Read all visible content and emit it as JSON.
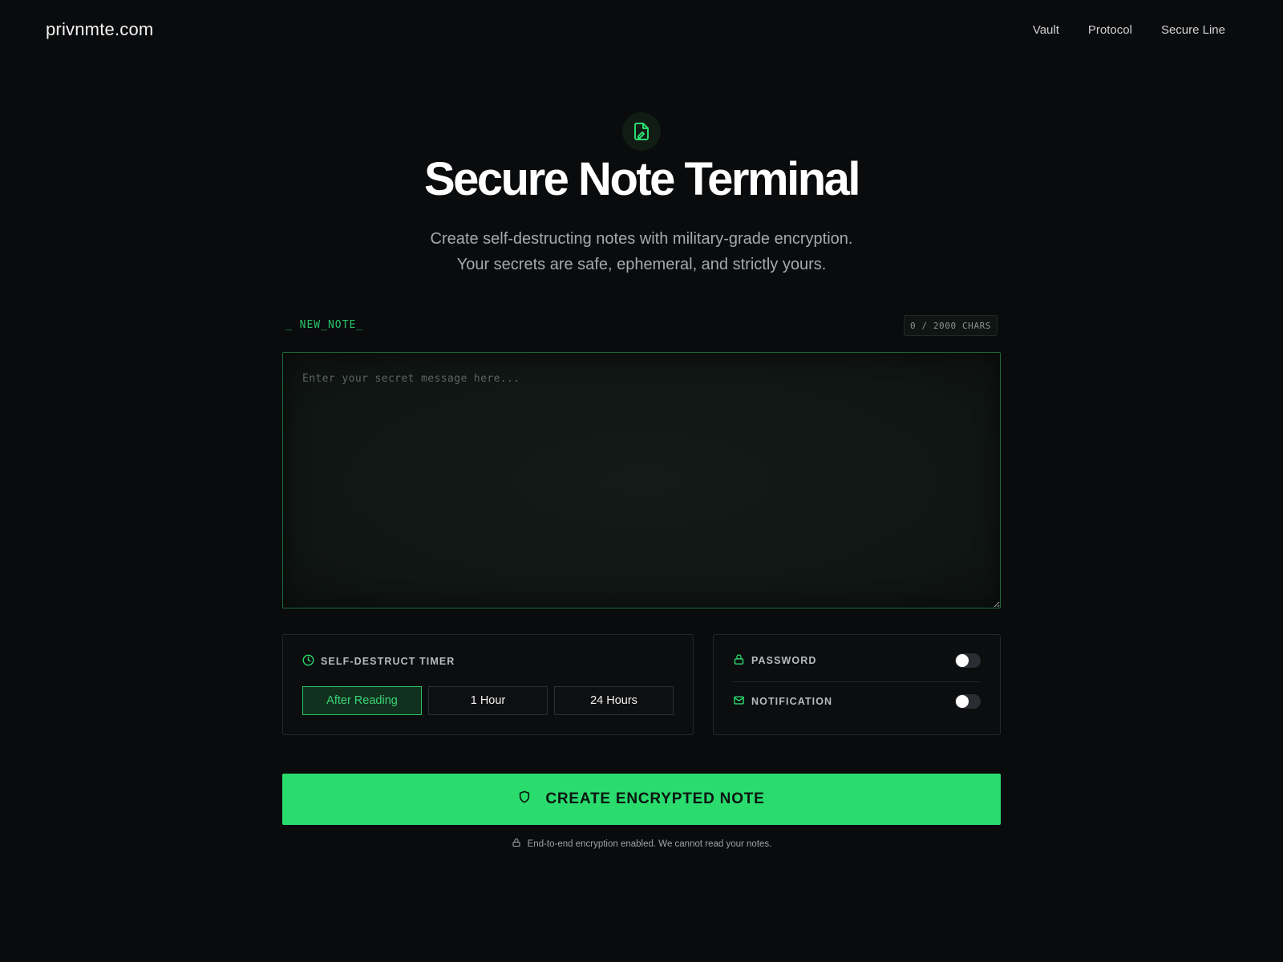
{
  "header": {
    "brand": "privnmte.com",
    "nav": [
      "Vault",
      "Protocol",
      "Secure Line"
    ]
  },
  "hero": {
    "icon": "document-edit-icon",
    "title": "Secure Note Terminal",
    "subtitle_line1": "Create self-destructing notes with military-grade encryption.",
    "subtitle_line2": "Your secrets are safe, ephemeral, and strictly yours."
  },
  "note": {
    "label": "_ NEW_NOTE_",
    "char_count": "0 / 2000 CHARS",
    "placeholder": "Enter your secret message here...",
    "value": ""
  },
  "timer": {
    "icon": "clock-icon",
    "title": "SELF-DESTRUCT TIMER",
    "options": [
      "After Reading",
      "1 Hour",
      "24 Hours"
    ],
    "selected": "After Reading"
  },
  "options": {
    "password": {
      "icon": "lock-icon",
      "label": "PASSWORD",
      "enabled": false
    },
    "notification": {
      "icon": "mail-icon",
      "label": "NOTIFICATION",
      "enabled": false
    }
  },
  "create_button": {
    "icon": "shield-icon",
    "label": "CREATE ENCRYPTED NOTE"
  },
  "footer": {
    "icon": "lock-icon",
    "text": "End-to-end encryption enabled. We cannot read your notes."
  },
  "colors": {
    "background": "#0a0b0d",
    "accent": "#2adb6d",
    "accent_text": "#27c566"
  }
}
